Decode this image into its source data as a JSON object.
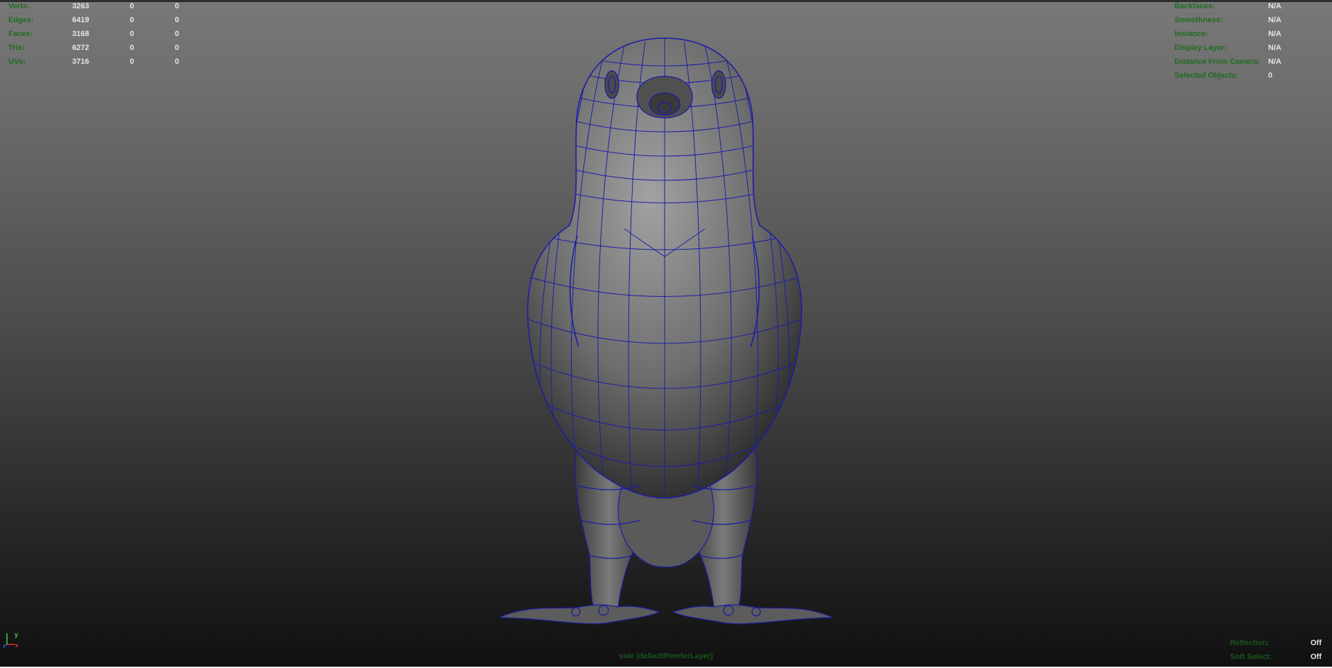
{
  "stats": {
    "rows": [
      {
        "label": "Verts:",
        "v1": "3263",
        "v2": "0",
        "v3": "0"
      },
      {
        "label": "Edges:",
        "v1": "6419",
        "v2": "0",
        "v3": "0"
      },
      {
        "label": "Faces:",
        "v1": "3168",
        "v2": "0",
        "v3": "0"
      },
      {
        "label": "Tris:",
        "v1": "6272",
        "v2": "0",
        "v3": "0"
      },
      {
        "label": "UVs:",
        "v1": "3716",
        "v2": "0",
        "v3": "0"
      }
    ]
  },
  "info": {
    "rows": [
      {
        "label": "Backfaces:",
        "value": "N/A"
      },
      {
        "label": "Smoothness:",
        "value": "N/A"
      },
      {
        "label": "Instance:",
        "value": "N/A"
      },
      {
        "label": "Display Layer:",
        "value": "N/A"
      },
      {
        "label": "Distance From Camera:",
        "value": "N/A"
      },
      {
        "label": "Selected Objects:",
        "value": "0"
      }
    ]
  },
  "bottom_info": {
    "rows": [
      {
        "label": "Reflection:",
        "value": "Off"
      },
      {
        "label": "Soft Select:",
        "value": "Off"
      }
    ]
  },
  "camera_label": "side (defaultRenderLayer)",
  "axis": {
    "y_label": "y",
    "x_label": "x",
    "z_label": "z"
  },
  "colors": {
    "hud_label": "#1f6b1f",
    "hud_value": "#e6e6e6",
    "wireframe": "#1c1ca8",
    "axis_x": "#e03030",
    "axis_y": "#50d050",
    "axis_z": "#3050e0"
  },
  "viewport": {
    "subject": "bird-mesh-wireframe-on-shaded"
  }
}
